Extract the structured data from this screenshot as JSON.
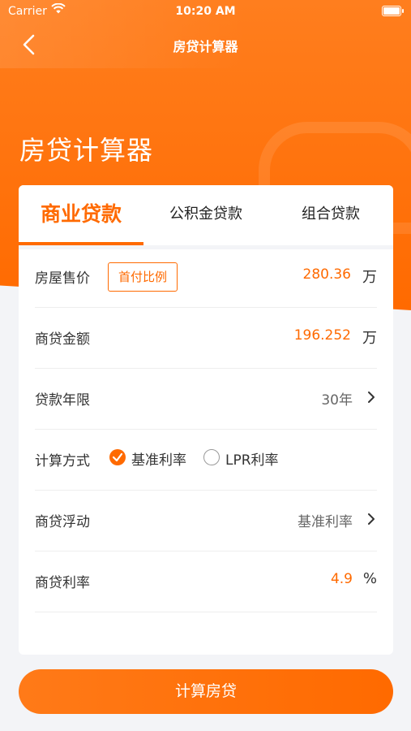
{
  "status": {
    "carrier": "Carrier",
    "time": "10:20 AM"
  },
  "nav": {
    "title": "房贷计算器"
  },
  "hero": {
    "title": "房贷计算器"
  },
  "tabs": [
    {
      "label": "商业贷款",
      "active": true
    },
    {
      "label": "公积金贷款",
      "active": false
    },
    {
      "label": "组合贷款",
      "active": false
    }
  ],
  "form": {
    "price": {
      "label": "房屋售价",
      "button": "首付比例",
      "value": "280.36",
      "unit": "万"
    },
    "loan_amount": {
      "label": "商贷金额",
      "value": "196.252",
      "unit": "万"
    },
    "term": {
      "label": "贷款年限",
      "value": "30年"
    },
    "method": {
      "label": "计算方式",
      "options": [
        {
          "label": "基准利率",
          "selected": true
        },
        {
          "label": "LPR利率",
          "selected": false
        }
      ]
    },
    "float": {
      "label": "商贷浮动",
      "value": "基准利率"
    },
    "rate": {
      "label": "商贷利率",
      "value": "4.9",
      "unit": "%"
    }
  },
  "actions": {
    "calculate": "计算房贷"
  },
  "colors": {
    "accent": "#ff6a00",
    "background": "#f3f4f7"
  }
}
